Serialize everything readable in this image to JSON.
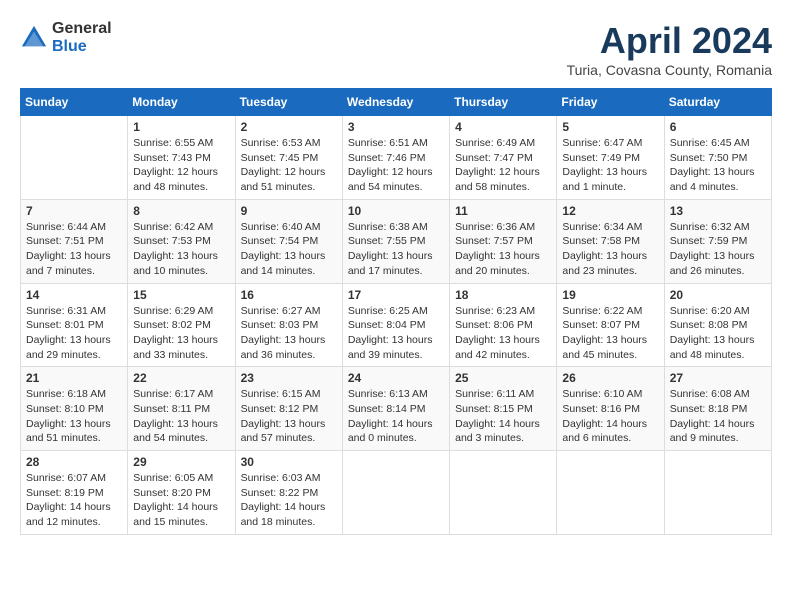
{
  "logo": {
    "general": "General",
    "blue": "Blue"
  },
  "title": "April 2024",
  "location": "Turia, Covasna County, Romania",
  "days_header": [
    "Sunday",
    "Monday",
    "Tuesday",
    "Wednesday",
    "Thursday",
    "Friday",
    "Saturday"
  ],
  "weeks": [
    [
      {
        "day": "",
        "info": ""
      },
      {
        "day": "1",
        "info": "Sunrise: 6:55 AM\nSunset: 7:43 PM\nDaylight: 12 hours\nand 48 minutes."
      },
      {
        "day": "2",
        "info": "Sunrise: 6:53 AM\nSunset: 7:45 PM\nDaylight: 12 hours\nand 51 minutes."
      },
      {
        "day": "3",
        "info": "Sunrise: 6:51 AM\nSunset: 7:46 PM\nDaylight: 12 hours\nand 54 minutes."
      },
      {
        "day": "4",
        "info": "Sunrise: 6:49 AM\nSunset: 7:47 PM\nDaylight: 12 hours\nand 58 minutes."
      },
      {
        "day": "5",
        "info": "Sunrise: 6:47 AM\nSunset: 7:49 PM\nDaylight: 13 hours\nand 1 minute."
      },
      {
        "day": "6",
        "info": "Sunrise: 6:45 AM\nSunset: 7:50 PM\nDaylight: 13 hours\nand 4 minutes."
      }
    ],
    [
      {
        "day": "7",
        "info": "Sunrise: 6:44 AM\nSunset: 7:51 PM\nDaylight: 13 hours\nand 7 minutes."
      },
      {
        "day": "8",
        "info": "Sunrise: 6:42 AM\nSunset: 7:53 PM\nDaylight: 13 hours\nand 10 minutes."
      },
      {
        "day": "9",
        "info": "Sunrise: 6:40 AM\nSunset: 7:54 PM\nDaylight: 13 hours\nand 14 minutes."
      },
      {
        "day": "10",
        "info": "Sunrise: 6:38 AM\nSunset: 7:55 PM\nDaylight: 13 hours\nand 17 minutes."
      },
      {
        "day": "11",
        "info": "Sunrise: 6:36 AM\nSunset: 7:57 PM\nDaylight: 13 hours\nand 20 minutes."
      },
      {
        "day": "12",
        "info": "Sunrise: 6:34 AM\nSunset: 7:58 PM\nDaylight: 13 hours\nand 23 minutes."
      },
      {
        "day": "13",
        "info": "Sunrise: 6:32 AM\nSunset: 7:59 PM\nDaylight: 13 hours\nand 26 minutes."
      }
    ],
    [
      {
        "day": "14",
        "info": "Sunrise: 6:31 AM\nSunset: 8:01 PM\nDaylight: 13 hours\nand 29 minutes."
      },
      {
        "day": "15",
        "info": "Sunrise: 6:29 AM\nSunset: 8:02 PM\nDaylight: 13 hours\nand 33 minutes."
      },
      {
        "day": "16",
        "info": "Sunrise: 6:27 AM\nSunset: 8:03 PM\nDaylight: 13 hours\nand 36 minutes."
      },
      {
        "day": "17",
        "info": "Sunrise: 6:25 AM\nSunset: 8:04 PM\nDaylight: 13 hours\nand 39 minutes."
      },
      {
        "day": "18",
        "info": "Sunrise: 6:23 AM\nSunset: 8:06 PM\nDaylight: 13 hours\nand 42 minutes."
      },
      {
        "day": "19",
        "info": "Sunrise: 6:22 AM\nSunset: 8:07 PM\nDaylight: 13 hours\nand 45 minutes."
      },
      {
        "day": "20",
        "info": "Sunrise: 6:20 AM\nSunset: 8:08 PM\nDaylight: 13 hours\nand 48 minutes."
      }
    ],
    [
      {
        "day": "21",
        "info": "Sunrise: 6:18 AM\nSunset: 8:10 PM\nDaylight: 13 hours\nand 51 minutes."
      },
      {
        "day": "22",
        "info": "Sunrise: 6:17 AM\nSunset: 8:11 PM\nDaylight: 13 hours\nand 54 minutes."
      },
      {
        "day": "23",
        "info": "Sunrise: 6:15 AM\nSunset: 8:12 PM\nDaylight: 13 hours\nand 57 minutes."
      },
      {
        "day": "24",
        "info": "Sunrise: 6:13 AM\nSunset: 8:14 PM\nDaylight: 14 hours\nand 0 minutes."
      },
      {
        "day": "25",
        "info": "Sunrise: 6:11 AM\nSunset: 8:15 PM\nDaylight: 14 hours\nand 3 minutes."
      },
      {
        "day": "26",
        "info": "Sunrise: 6:10 AM\nSunset: 8:16 PM\nDaylight: 14 hours\nand 6 minutes."
      },
      {
        "day": "27",
        "info": "Sunrise: 6:08 AM\nSunset: 8:18 PM\nDaylight: 14 hours\nand 9 minutes."
      }
    ],
    [
      {
        "day": "28",
        "info": "Sunrise: 6:07 AM\nSunset: 8:19 PM\nDaylight: 14 hours\nand 12 minutes."
      },
      {
        "day": "29",
        "info": "Sunrise: 6:05 AM\nSunset: 8:20 PM\nDaylight: 14 hours\nand 15 minutes."
      },
      {
        "day": "30",
        "info": "Sunrise: 6:03 AM\nSunset: 8:22 PM\nDaylight: 14 hours\nand 18 minutes."
      },
      {
        "day": "",
        "info": ""
      },
      {
        "day": "",
        "info": ""
      },
      {
        "day": "",
        "info": ""
      },
      {
        "day": "",
        "info": ""
      }
    ]
  ]
}
